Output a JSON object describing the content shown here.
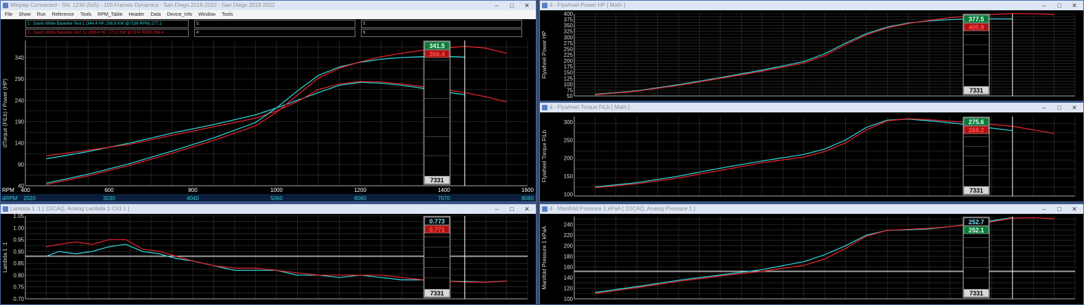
{
  "colors": {
    "cyan": "#2fd3d8",
    "red": "#e0252b",
    "grid": "#3a3a3a",
    "axis": "#b0b0b0",
    "hair": "#ffffff",
    "green_box": "#0a7a3a",
    "red_box": "#b01010",
    "dark": "#000000"
  },
  "main": {
    "title": "Winpep Connected - SN: 1234 (5x5) - 100 Frames  Dynamics - San Diego  2019-2022 - San Diego  2019 2022",
    "menu": [
      "File",
      "Show",
      "Run",
      "Reference",
      "Tools",
      "RPM_Table",
      "Header",
      "Data",
      "Device_Info",
      "Window",
      "Tools"
    ],
    "legend": [
      {
        "id": "1:",
        "text": "Gavin White Baseline Test 1 (344.4 HP, 256.8 KW @7198 RPM) 277.1",
        "color": "cyan"
      },
      {
        "id": "2:",
        "text": "Gavin White Baseline Test 11 (366.4 HP, 273.2 KW @7374 RPM) 268.4",
        "color": "red"
      },
      {
        "id": "3:",
        "text": "",
        "color": "cyan"
      },
      {
        "id": "4:",
        "text": "",
        "color": "cyan"
      },
      {
        "id": "5:",
        "text": "",
        "color": "cyan"
      },
      {
        "id": "6:",
        "text": "",
        "color": "cyan"
      }
    ]
  },
  "chart_data": [
    {
      "id": "torque_power",
      "type": "line",
      "ylabel": "dTorque (FtLb) / Power (HP)",
      "xlabel": "RPM",
      "x_ticks": [
        400,
        600,
        800,
        1000,
        1200,
        1400,
        1600
      ],
      "y_ticks": [
        40,
        90,
        140,
        190,
        240,
        290,
        340
      ],
      "y_tick_labels": [
        "40",
        "90",
        "140",
        "190",
        "240",
        "290",
        "340"
      ],
      "ylim": [
        40,
        380
      ],
      "xlim": [
        400,
        1600
      ],
      "cursor_x": 1450,
      "drpm_label": "dRPM",
      "drpm_ticks": [
        "2020",
        "3030",
        "4040",
        "5060",
        "6060",
        "7070",
        "8080"
      ],
      "readouts": [
        {
          "value": "341.5",
          "style": "green"
        },
        {
          "value": "366.4",
          "style": "red"
        }
      ],
      "rpm_box": "7331",
      "series": [
        {
          "color": "cyan",
          "x": [
            450,
            550,
            650,
            750,
            850,
            950,
            1000,
            1050,
            1100,
            1150,
            1200,
            1250,
            1300,
            1350,
            1400,
            1450,
            1450
          ],
          "values": [
            103,
            120,
            140,
            163,
            183,
            206,
            222,
            240,
            258,
            275,
            282,
            280,
            275,
            268,
            260,
            253,
            245
          ]
        },
        {
          "color": "red",
          "x": [
            450,
            550,
            650,
            750,
            850,
            950,
            1000,
            1050,
            1100,
            1150,
            1200,
            1250,
            1300,
            1350,
            1400,
            1450,
            1500,
            1550
          ],
          "values": [
            110,
            123,
            137,
            158,
            178,
            198,
            215,
            237,
            265,
            278,
            284,
            283,
            278,
            272,
            265,
            258,
            248,
            236
          ]
        },
        {
          "color": "cyan",
          "x": [
            450,
            550,
            650,
            750,
            850,
            950,
            1000,
            1050,
            1100,
            1150,
            1200,
            1250,
            1300,
            1350,
            1400,
            1450
          ],
          "values": [
            46,
            67,
            92,
            121,
            152,
            188,
            222,
            262,
            298,
            318,
            329,
            336,
            340,
            342,
            343,
            341
          ]
        },
        {
          "color": "red",
          "x": [
            450,
            550,
            650,
            750,
            850,
            950,
            1000,
            1050,
            1100,
            1150,
            1200,
            1250,
            1300,
            1350,
            1400,
            1450,
            1500,
            1550
          ],
          "values": [
            43,
            63,
            88,
            116,
            146,
            180,
            212,
            252,
            292,
            315,
            330,
            342,
            350,
            357,
            362,
            366,
            362,
            350
          ]
        }
      ]
    },
    {
      "id": "lambda",
      "type": "line",
      "ylabel": "Lambda 1 :1",
      "title": "Lambda 1   [ 1DCAQ, Analog Lambda 1 Ch3 1 ]",
      "y_ticks": [
        0.7,
        0.75,
        0.8,
        0.85,
        0.9,
        0.95,
        1.0,
        1.05
      ],
      "y_tick_labels": [
        "0.70",
        "0.75",
        "0.80",
        "0.85",
        "0.90",
        "0.95",
        "1.00",
        "1.05"
      ],
      "ylim": [
        0.7,
        1.05
      ],
      "xlim": [
        400,
        1600
      ],
      "cursor_x": 1450,
      "ref_line": 0.88,
      "readouts": [
        {
          "value": "0.773",
          "style": "dark"
        },
        {
          "value": "0.771",
          "style": "red"
        }
      ],
      "rpm_box": "7331",
      "series": [
        {
          "color": "cyan",
          "x": [
            450,
            480,
            520,
            560,
            600,
            640,
            680,
            720,
            760,
            800,
            850,
            900,
            950,
            1000,
            1050,
            1100,
            1150,
            1200,
            1250,
            1300,
            1350,
            1400,
            1450,
            1500,
            1550
          ],
          "values": [
            0.88,
            0.9,
            0.89,
            0.9,
            0.92,
            0.93,
            0.9,
            0.89,
            0.87,
            0.86,
            0.84,
            0.82,
            0.82,
            0.82,
            0.8,
            0.8,
            0.79,
            0.8,
            0.79,
            0.78,
            0.78,
            0.775,
            0.773,
            0.77,
            0.775
          ]
        },
        {
          "color": "red",
          "x": [
            450,
            480,
            520,
            560,
            600,
            640,
            680,
            720,
            760,
            800,
            850,
            900,
            950,
            1000,
            1050,
            1100,
            1150,
            1200,
            1250,
            1300,
            1350,
            1400,
            1450,
            1500,
            1550
          ],
          "values": [
            0.92,
            0.93,
            0.94,
            0.93,
            0.95,
            0.95,
            0.91,
            0.9,
            0.88,
            0.86,
            0.84,
            0.83,
            0.83,
            0.82,
            0.81,
            0.8,
            0.8,
            0.8,
            0.8,
            0.79,
            0.78,
            0.775,
            0.771,
            0.77,
            0.775
          ]
        }
      ]
    },
    {
      "id": "flywheel_power",
      "type": "line",
      "ylabel": "Flywheel Power HP",
      "title": "Flywheel Power   HP   [ Math ]",
      "y_ticks": [
        50,
        75,
        100,
        125,
        150,
        175,
        200,
        225,
        250,
        275,
        300,
        325,
        350,
        375,
        400
      ],
      "y_tick_labels": [
        "50",
        "75",
        "100",
        "125",
        "150",
        "175",
        "200",
        "225",
        "250",
        "275",
        "300",
        "325",
        "350",
        "375",
        "400"
      ],
      "ylim": [
        50,
        400
      ],
      "xlim": [
        400,
        1600
      ],
      "cursor_x": 1450,
      "readouts": [
        {
          "value": "377.5",
          "style": "green"
        },
        {
          "value": "400.9",
          "style": "red"
        }
      ],
      "rpm_box": "7331",
      "series": [
        {
          "color": "cyan",
          "x": [
            450,
            550,
            650,
            750,
            850,
            950,
            1000,
            1050,
            1100,
            1150,
            1200,
            1250,
            1300,
            1350,
            1400,
            1450
          ],
          "values": [
            57,
            72,
            98,
            128,
            160,
            196,
            230,
            275,
            315,
            343,
            360,
            370,
            375,
            378,
            378,
            378
          ]
        },
        {
          "color": "red",
          "x": [
            450,
            550,
            650,
            750,
            850,
            950,
            1000,
            1050,
            1100,
            1150,
            1200,
            1250,
            1300,
            1350,
            1400,
            1450,
            1500,
            1550
          ],
          "values": [
            55,
            70,
            95,
            125,
            155,
            190,
            222,
            268,
            310,
            340,
            358,
            372,
            383,
            390,
            396,
            401,
            400,
            396
          ]
        }
      ]
    },
    {
      "id": "flywheel_torque",
      "type": "line",
      "ylabel": "Flywheel Torque FtLb",
      "title": "Flywheel Torque FtLb   [ Math ]",
      "y_ticks": [
        100,
        150,
        200,
        250,
        300
      ],
      "y_tick_labels": [
        "100",
        "150",
        "200",
        "250",
        "300"
      ],
      "ylim": [
        95,
        315
      ],
      "xlim": [
        400,
        1600
      ],
      "cursor_x": 1450,
      "readouts": [
        {
          "value": "275.6",
          "style": "green"
        },
        {
          "value": "269.2",
          "style": "red"
        }
      ],
      "rpm_box": "7331",
      "series": [
        {
          "color": "cyan",
          "x": [
            450,
            550,
            650,
            750,
            850,
            950,
            1000,
            1050,
            1100,
            1150,
            1200,
            1250,
            1300,
            1350,
            1400,
            1450
          ],
          "values": [
            120,
            132,
            150,
            172,
            192,
            210,
            225,
            250,
            285,
            305,
            308,
            303,
            298,
            291,
            283,
            276
          ]
        },
        {
          "color": "red",
          "x": [
            450,
            550,
            650,
            750,
            850,
            950,
            1000,
            1050,
            1100,
            1150,
            1200,
            1250,
            1300,
            1350,
            1400,
            1450,
            1500,
            1550
          ],
          "values": [
            118,
            129,
            145,
            166,
            187,
            203,
            218,
            242,
            278,
            303,
            309,
            306,
            302,
            298,
            293,
            288,
            278,
            268
          ]
        }
      ]
    },
    {
      "id": "manifold_pressure",
      "type": "line",
      "ylabel": "Manifold Pressure 1 kPaA",
      "title": "Manifold Pressure 1 kPaA   [ 1DCAQ, Analog Pressure 1 ]",
      "y_ticks": [
        100,
        120,
        140,
        160,
        180,
        200,
        220,
        240
      ],
      "y_tick_labels": [
        "100",
        "120",
        "140",
        "160",
        "180",
        "200",
        "220",
        "240"
      ],
      "ylim": [
        100,
        255
      ],
      "xlim": [
        400,
        1600
      ],
      "cursor_x": 1450,
      "ref_line": 152,
      "readouts": [
        {
          "value": "252.7",
          "style": "dark"
        },
        {
          "value": "252.1",
          "style": "green"
        }
      ],
      "rpm_box": "7331",
      "series": [
        {
          "color": "cyan",
          "x": [
            450,
            550,
            650,
            750,
            850,
            950,
            1000,
            1050,
            1100,
            1150,
            1200,
            1250,
            1300,
            1350,
            1400,
            1450
          ],
          "values": [
            112,
            123,
            135,
            145,
            155,
            170,
            183,
            200,
            220,
            229,
            230,
            232,
            236,
            241,
            247,
            253
          ]
        },
        {
          "color": "red",
          "x": [
            450,
            550,
            650,
            750,
            850,
            950,
            1000,
            1050,
            1100,
            1150,
            1200,
            1250,
            1300,
            1350,
            1400,
            1450,
            1500,
            1550
          ],
          "values": [
            110,
            121,
            133,
            143,
            152,
            163,
            175,
            195,
            218,
            229,
            231,
            233,
            236,
            240,
            245,
            252,
            253,
            251
          ]
        }
      ]
    }
  ],
  "panels": {
    "lambda_title": "Lambda 1 :1   [ 1DCAQ, Analog Lambda 1 Ch3 1 ]",
    "fp_title": "4 - Flywheel Power HP   [ Math ]",
    "ft_title": "4 - Flywheel Torque FtLb   [ Math ]",
    "mp_title": "4 - Manifold Pressure 1 kPaA   [ 1DCAQ, Analog Pressure 1 ]"
  }
}
